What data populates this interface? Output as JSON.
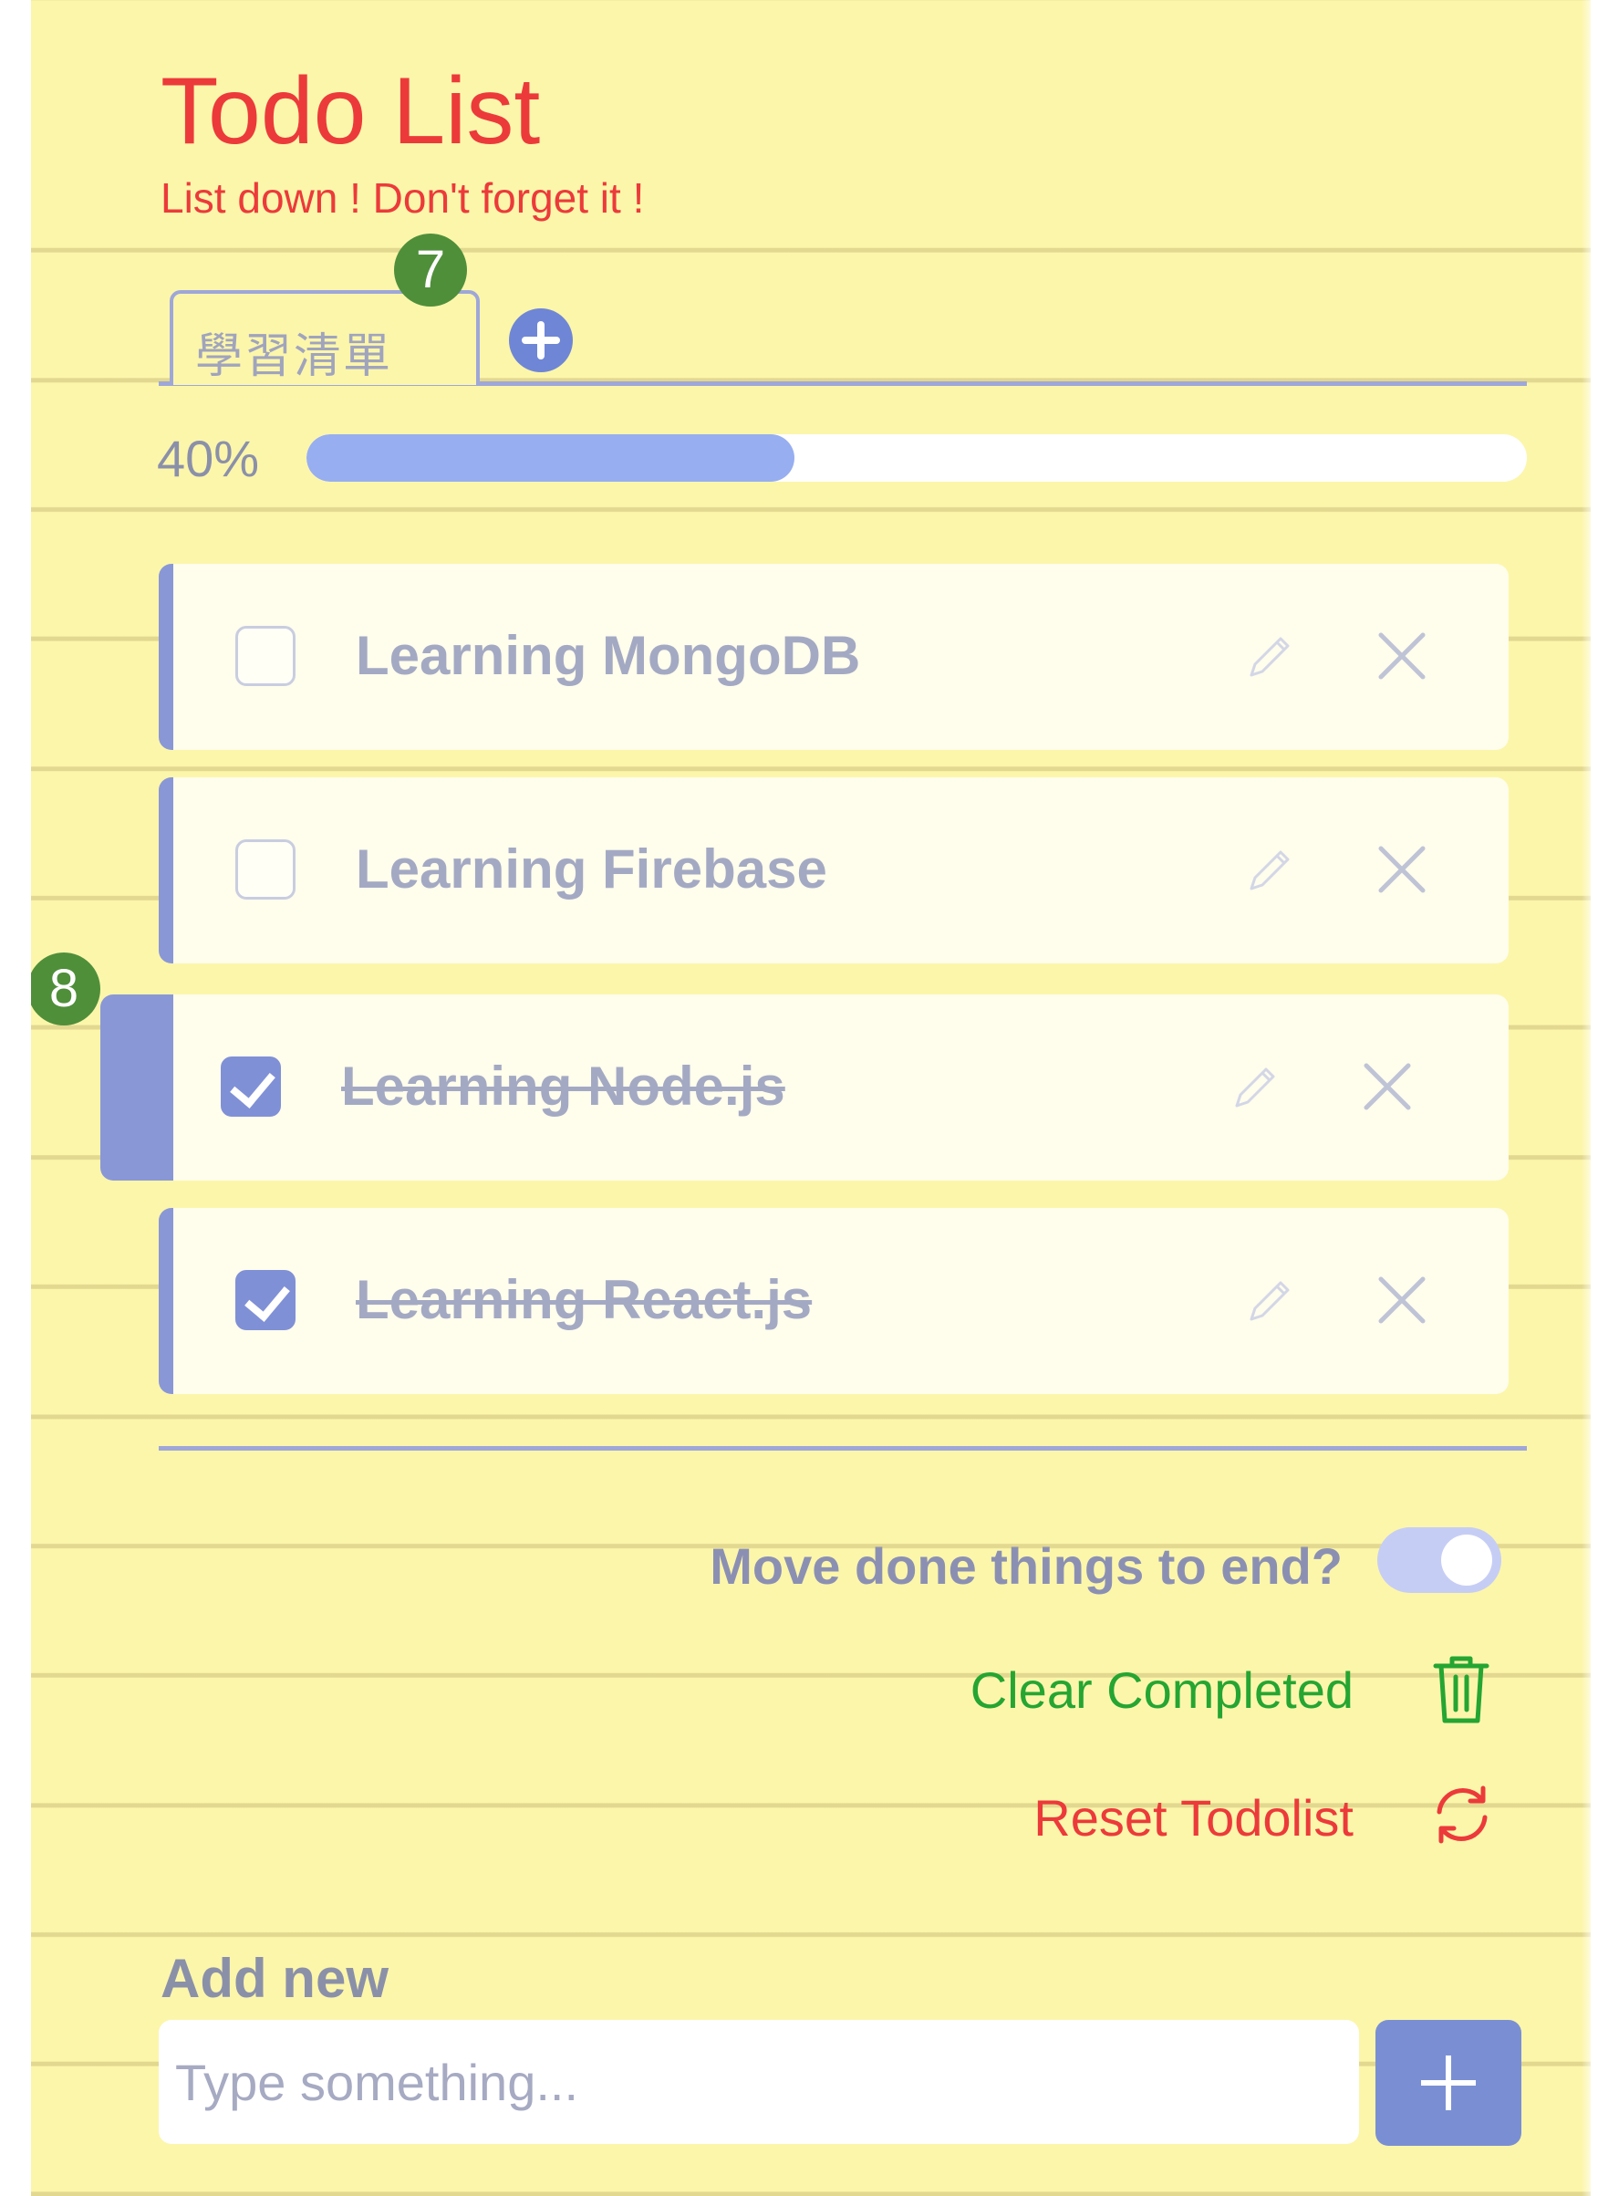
{
  "header": {
    "title": "Todo List",
    "subtitle": "List down ! Don't forget it !"
  },
  "tabs": [
    {
      "label": "學習清單",
      "active": true
    }
  ],
  "add_tab_icon": "plus-circle-icon",
  "annotations": [
    "7",
    "8"
  ],
  "progress": {
    "label": "40%",
    "value": 0.4
  },
  "todos": [
    {
      "text": "Learning MongoDB",
      "done": false
    },
    {
      "text": "Learning Firebase",
      "done": false
    },
    {
      "text": "Learning Node.js",
      "done": true
    },
    {
      "text": "Learning React.js",
      "done": true
    }
  ],
  "todo_icons": {
    "edit": "pencil-icon",
    "delete": "close-icon"
  },
  "options": {
    "move_done_label": "Move done things to end?",
    "move_done_enabled": true
  },
  "actions": {
    "clear_completed": "Clear Completed",
    "reset_todolist": "Reset Todolist"
  },
  "add_new": {
    "label": "Add new",
    "placeholder": "Type something...",
    "button_icon": "plus-icon"
  },
  "colors": {
    "paper": "#fcf6ab",
    "title": "#ec3a3a",
    "accent": "#8a97d6",
    "progress_fill": "#97aef0",
    "clear": "#25a532",
    "reset": "#ec3a3a",
    "badge": "#4f8f3a"
  }
}
